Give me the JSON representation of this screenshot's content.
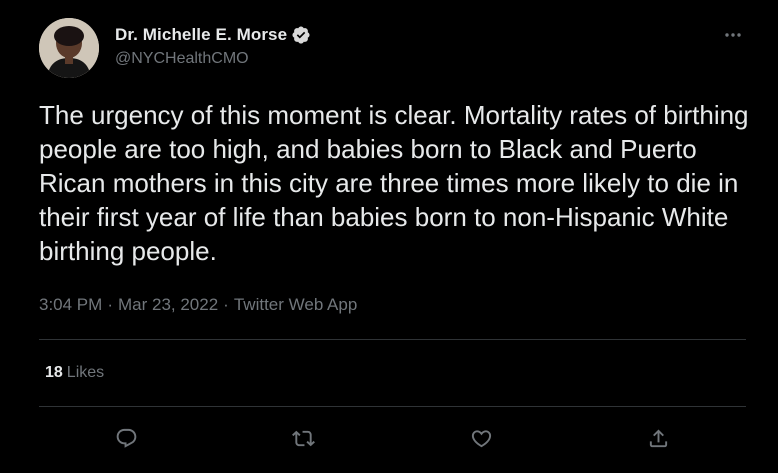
{
  "author": {
    "display_name": "Dr. Michelle E. Morse",
    "handle": "@NYCHealthCMO",
    "verified": true
  },
  "tweet": {
    "text": "The urgency of this moment is clear. Mortality rates of birthing people are too high, and babies born to Black and Puerto Rican mothers in this city are three times more likely to die in their first year of life than babies born to non-Hispanic White birthing people.",
    "time": "3:04 PM",
    "separator": "·",
    "date": "Mar 23, 2022",
    "source": "Twitter Web App"
  },
  "stats": {
    "likes_count": "18",
    "likes_label": "Likes"
  },
  "actions": {
    "reply_icon": "reply-icon",
    "retweet_icon": "retweet-icon",
    "like_icon": "heart-icon",
    "share_icon": "share-icon"
  },
  "colors": {
    "background": "#000000",
    "text_primary": "#e7e9ea",
    "text_secondary": "#71767b",
    "divider": "#2f3336"
  }
}
